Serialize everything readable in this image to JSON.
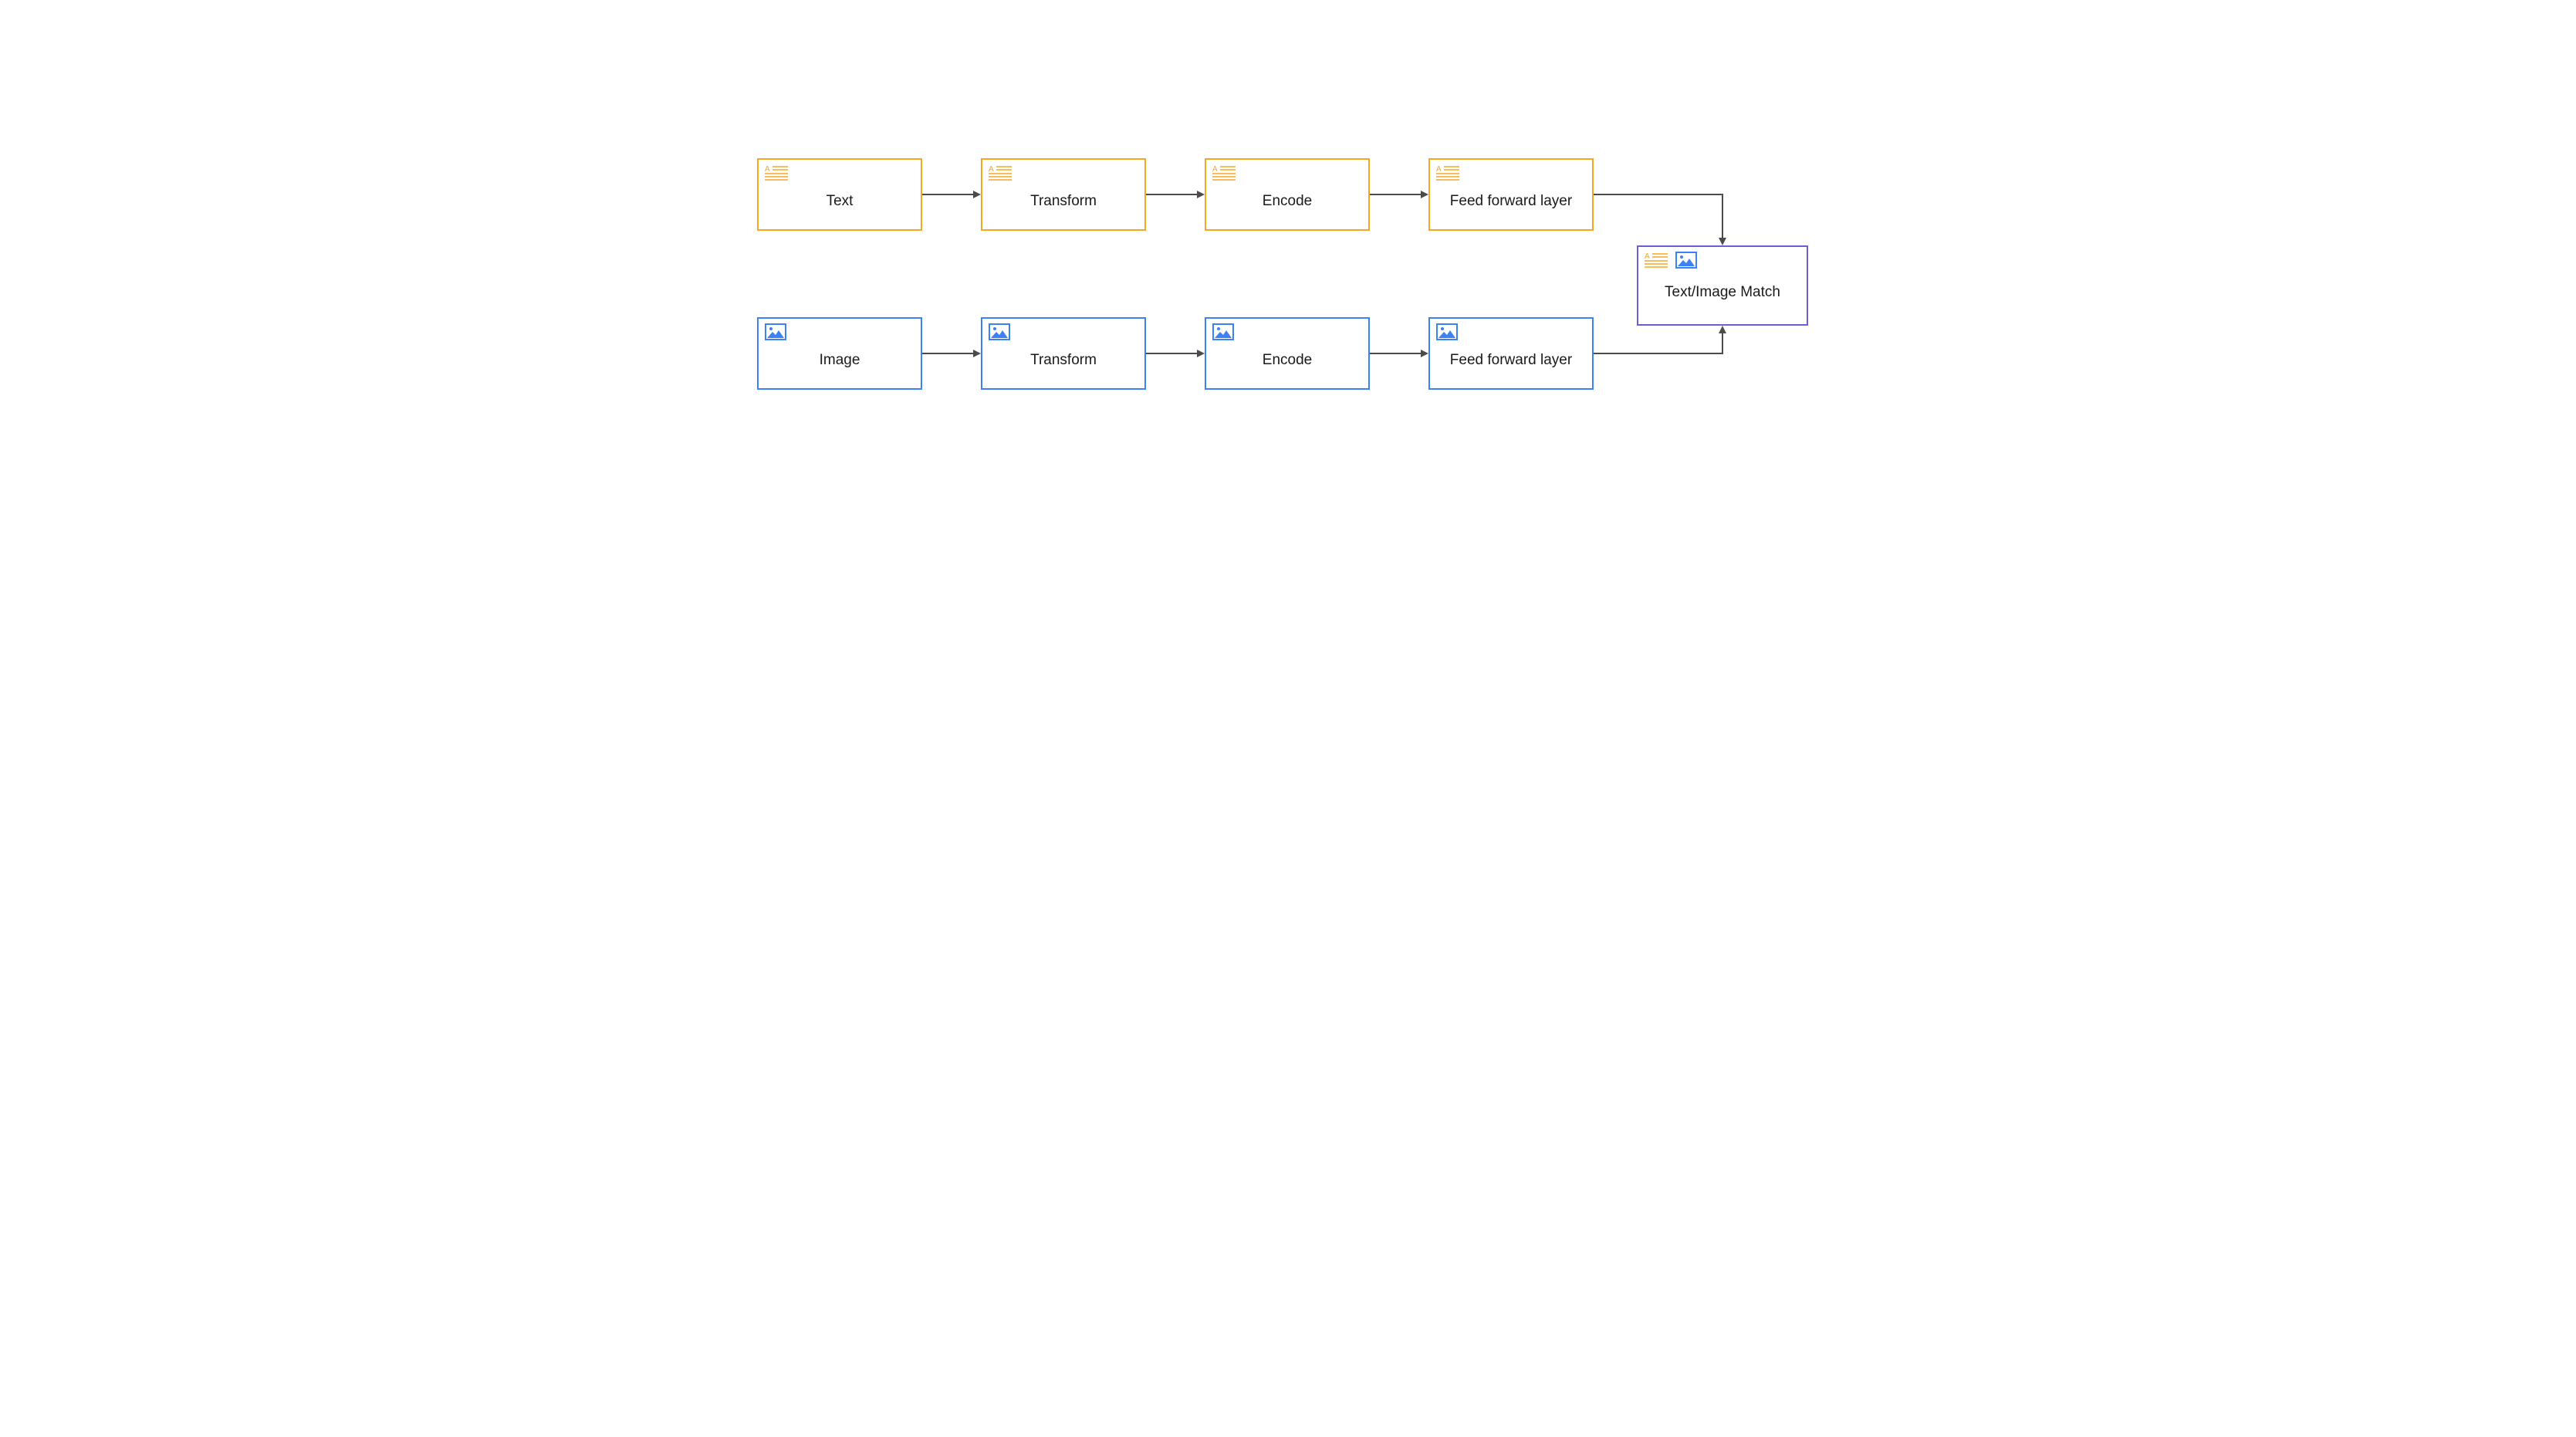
{
  "colors": {
    "orange": "#f5a623",
    "blue": "#3b82f6",
    "purple": "#6f5bd6",
    "arrow": "#4b4b4b"
  },
  "nodes": {
    "text_row": [
      {
        "id": "text-input",
        "label": "Text"
      },
      {
        "id": "text-transform",
        "label": "Transform"
      },
      {
        "id": "text-encode",
        "label": "Encode"
      },
      {
        "id": "text-ff",
        "label": "Feed forward layer"
      }
    ],
    "image_row": [
      {
        "id": "image-input",
        "label": "Image"
      },
      {
        "id": "image-transform",
        "label": "Transform"
      },
      {
        "id": "image-encode",
        "label": "Encode"
      },
      {
        "id": "image-ff",
        "label": "Feed forward layer"
      }
    ],
    "output": {
      "id": "match",
      "label": "Text/Image Match"
    }
  },
  "icons": {
    "text": "text-lines-icon",
    "image": "image-icon"
  }
}
